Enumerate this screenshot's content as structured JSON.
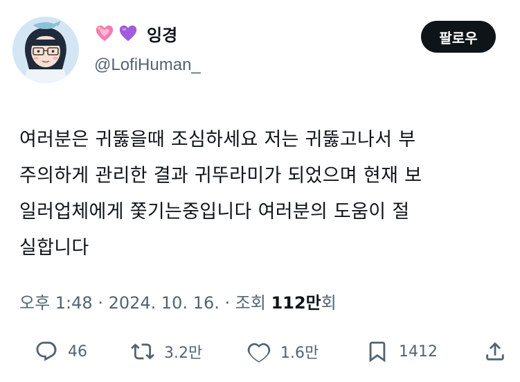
{
  "author": {
    "display_name": "잉경",
    "handle": "@LofiHuman_",
    "name_icons": [
      "sparkling-heart-icon",
      "purple-heart-icon"
    ],
    "colors": {
      "pink_heart": "#f57bb6",
      "purple_heart": "#a25bdc"
    }
  },
  "follow_button": {
    "label": "팔로우"
  },
  "tweet": {
    "text": "여러분은 귀뚫을때 조심하세요 저는 귀뚫고나서 부\n주의하게 관리한 결과 귀뚜라미가 되었으며 현재 보\n일러업체에게 쫓기는중입니다 여러분의 도움이 절\n실합니다"
  },
  "meta": {
    "time": "오후 1:48",
    "separator": " · ",
    "date": "2024. 10. 16.",
    "views_label": "조회 ",
    "views_count": "112만",
    "views_suffix": "회"
  },
  "actions": {
    "replies": "46",
    "retweets": "3.2만",
    "likes": "1.6만",
    "bookmarks": "1412",
    "icons": [
      "reply-icon",
      "retweet-icon",
      "like-icon",
      "bookmark-icon",
      "share-icon"
    ]
  }
}
